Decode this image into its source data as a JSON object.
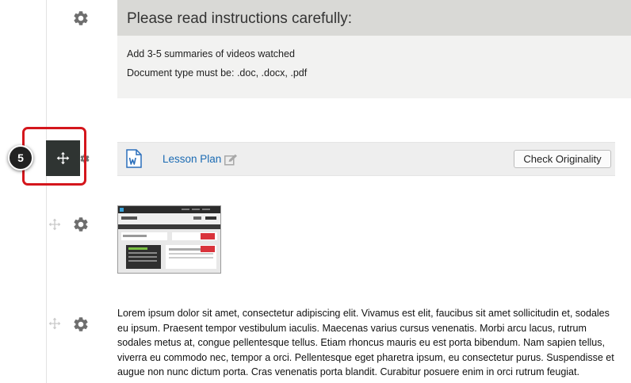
{
  "instructions": {
    "title": "Please read instructions carefully:",
    "lines": [
      "Add 3-5 summaries of videos watched",
      "Document type must be: .doc, .docx, .pdf"
    ]
  },
  "lesson_plan": {
    "link_label": "Lesson Plan",
    "check_button_label": "Check Originality",
    "file_icon": "word-document-icon",
    "edit_icon": "edit-icon"
  },
  "callout": {
    "step_number": "5",
    "handle_icon": "move-icon",
    "highlight_color": "#d4161c"
  },
  "icons": {
    "settings": "gear-icon",
    "move": "move-icon"
  },
  "paragraph": {
    "text": "Lorem ipsum dolor sit amet, consectetur adipiscing elit. Vivamus est elit, faucibus sit amet sollicitudin et, sodales eu ipsum. Praesent tempor vestibulum iaculis. Maecenas varius cursus venenatis. Morbi arcu lacus, rutrum sodales metus at, congue pellentesque tellus. Etiam rhoncus mauris eu est porta bibendum. Nam sapien tellus, viverra eu commodo nec, tempor a orci. Pellentesque eget pharetra ipsum, eu consectetur purus. Suspendisse et augue non nunc dictum porta. Cras venenatis porta blandit. Curabitur posuere enim in orci rutrum feugiat."
  },
  "colors": {
    "link": "#1b6bb3",
    "header_bg": "#d9d9d6",
    "body_bg": "#f2f2f1",
    "handle_bg": "#2f3432"
  }
}
